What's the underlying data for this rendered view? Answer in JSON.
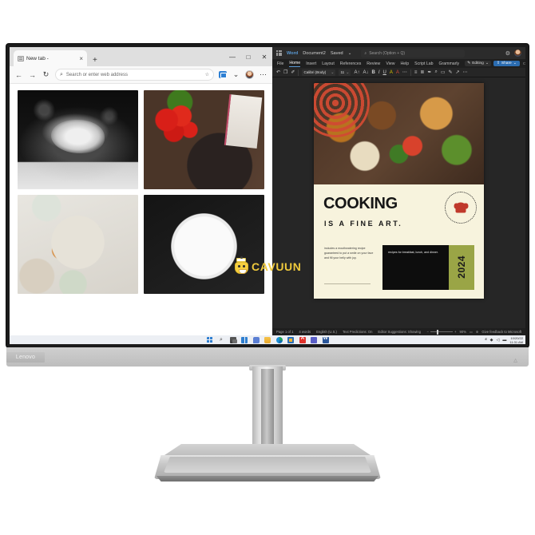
{
  "browser": {
    "tab": {
      "title": "New tab -",
      "close_label": "×",
      "favicon": "page-icon"
    },
    "new_tab_label": "+",
    "window_controls": {
      "minimize": "—",
      "maximize": "□",
      "close": "✕"
    },
    "toolbar": {
      "back": "←",
      "forward": "→",
      "refresh": "↻",
      "address_placeholder": "Search or enter web address",
      "search_icon": "⌕",
      "favorites_icon": "☆",
      "collections_icon": "collections-icon",
      "chevron": "⌄",
      "more_icon": "⋯"
    },
    "gallery": [
      {
        "name": "hands-clapping-flour",
        "alt": "Hands clapping flour on black background"
      },
      {
        "name": "tomatoes-skillet-eggs",
        "alt": "Cherry tomatoes, wooden spoon and skillet with eggs in tomato sauce"
      },
      {
        "name": "roasted-vegetable-platter",
        "alt": "Roasted vegetables and greens on a platter"
      },
      {
        "name": "greek-salad-plate",
        "alt": "Greek salad with feta and tomatoes on a white plate"
      }
    ]
  },
  "word": {
    "app_name": "Word",
    "document_title": "Document2",
    "save_state": "Saved",
    "save_chevron": "⌄",
    "waffle_icon": "app-launcher-icon",
    "search_placeholder": "Search (Option + Q)",
    "search_icon": "⌕",
    "settings_icon": "⚙",
    "ribbon_tabs": [
      {
        "label": "File",
        "active": false
      },
      {
        "label": "Home",
        "active": true
      },
      {
        "label": "Insert",
        "active": false
      },
      {
        "label": "Layout",
        "active": false
      },
      {
        "label": "References",
        "active": false
      },
      {
        "label": "Review",
        "active": false
      },
      {
        "label": "View",
        "active": false
      },
      {
        "label": "Help",
        "active": false
      },
      {
        "label": "Script Lab",
        "active": false
      },
      {
        "label": "Grammarly",
        "active": false
      }
    ],
    "editing_button": "Editing",
    "editing_chevron": "⌄",
    "editing_icon": "✎",
    "share_button": "Share",
    "share_icon": "⇪",
    "share_chevron": "⌄",
    "comments_icon": "▭",
    "ribbon_more_icon": "⋯",
    "ribbon": {
      "undo_icon": "↶",
      "paste_icon": "❐",
      "format_painter_icon": "✐",
      "font_name": "Calibri (Body)",
      "font_size": "11",
      "grow_font": "A↑",
      "shrink_font": "A↓",
      "bold": "B",
      "italic": "I",
      "underline": "U",
      "highlight": "A",
      "font_color": "A",
      "more_font": "⋯",
      "bullets_icon": "≡",
      "numbering_icon": "≣",
      "styles_icon": "✒",
      "find_icon": "⌕",
      "dictate_icon": "▭",
      "editor_icon": "✎",
      "reuse_icon": "↗",
      "more_icon": "⋯"
    },
    "page": {
      "title": "COOKING",
      "subtitle": "IS A FINE ART.",
      "badge_text": "YOUR FAVORITE FOOD RECIPES SINCE 2006",
      "badge_icon": "chef-hat-icon",
      "blurb": "includes a mouthwatering recipe guaranteed to put a smile on your face and fill your belly with joy.",
      "panel_text": "recipes for breakfast, lunch, and dinner.",
      "year": "2024"
    },
    "status": {
      "page_of": "Page 1 of 1",
      "word_count": "4 words",
      "language": "English (U.S.)",
      "text_predictions": "Text Predictions: On",
      "editor_suggestions": "Editor Suggestions: Showing",
      "zoom_minus": "−",
      "zoom_plus": "+",
      "zoom_level": "90%",
      "view_print_icon": "▭",
      "focus_icon": "✲",
      "feedback": "Give feedback to Microsoft"
    }
  },
  "watermark": {
    "text": "CAVUUN",
    "logo": "cavuun-chef-logo"
  },
  "taskbar": {
    "items": [
      {
        "name": "start-button",
        "label": "Start"
      },
      {
        "name": "search-icon",
        "label": "Search"
      },
      {
        "name": "task-view-icon",
        "label": "Task View"
      },
      {
        "name": "widgets-icon",
        "label": "Widgets"
      },
      {
        "name": "chat-icon",
        "label": "Chat"
      },
      {
        "name": "file-explorer-icon",
        "label": "File Explorer"
      },
      {
        "name": "edge-icon",
        "label": "Microsoft Edge"
      },
      {
        "name": "microsoft-store-icon",
        "label": "Microsoft Store"
      },
      {
        "name": "acrobat-icon",
        "label": "Adobe Acrobat"
      },
      {
        "name": "teams-icon",
        "label": "Microsoft Teams"
      },
      {
        "name": "word-icon",
        "label": "Microsoft Word"
      }
    ],
    "tray": {
      "overflow_icon": "ⱏ",
      "network_icon": "◆",
      "volume_icon": "◁",
      "battery_icon": "▬",
      "date": "10/20/22",
      "time": "11:31 AM"
    }
  },
  "monitor": {
    "brand": "Lenovo",
    "power_led": "△"
  }
}
